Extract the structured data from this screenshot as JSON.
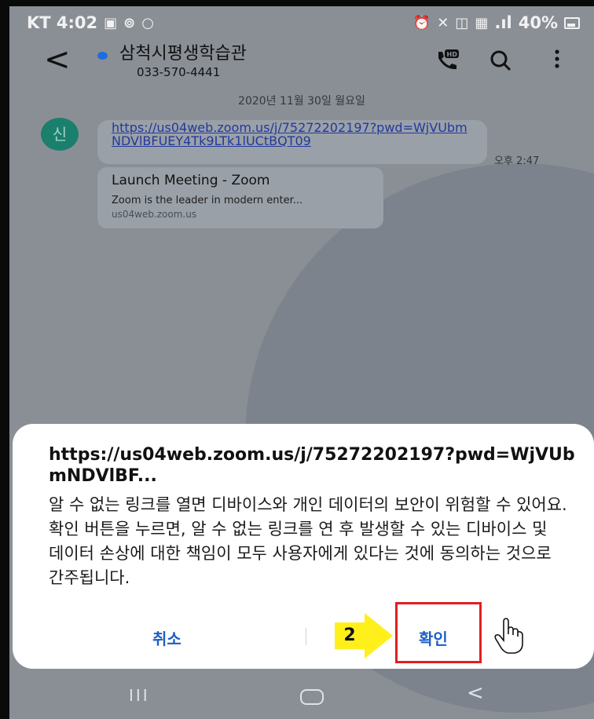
{
  "statusbar": {
    "carrier_time": "KT 4:02",
    "signal": ".ıl",
    "battery": "40%"
  },
  "header": {
    "back_icon": "<",
    "contact_name": "삼척시평생학습관",
    "phone": "033-570-4441"
  },
  "chat": {
    "date": "2020년 11월 30일 월요일",
    "avatar_initial": "신",
    "message_link": "https://us04web.zoom.us/j/75272202197?pwd=WjVUbmNDVlBFUEY4Tk9LTk1lUCtBQT09",
    "time": "오후 2:47",
    "preview_title": "Launch Meeting - Zoom",
    "preview_desc": "Zoom is the leader in modern enter...",
    "preview_url": "us04web.zoom.us"
  },
  "dialog": {
    "title": "https://us04web.zoom.us/j/75272202197?pwd=WjVUbmNDVlBF...",
    "body": "알 수 없는 링크를 열면 디바이스와 개인 데이터의 보안이 위험할 수 있어요. 확인 버튼을 누르면, 알 수 없는 링크를 연 후 발생할 수 있는 디바이스 및 데이터 손상에 대한 책임이 모두 사용자에게 있다는 것에 동의하는 것으로 간주됩니다.",
    "cancel_label": "취소",
    "ok_label": "확인"
  },
  "annotation": {
    "step_number": "2",
    "highlight_color": "#e02020",
    "step_color": "#ffef1a"
  },
  "navbar": {
    "recent_icon": "III",
    "back_icon": "<"
  },
  "colors": {
    "link": "#22399a",
    "button": "#1e5fc4",
    "avatar": "#1b7f6d"
  }
}
